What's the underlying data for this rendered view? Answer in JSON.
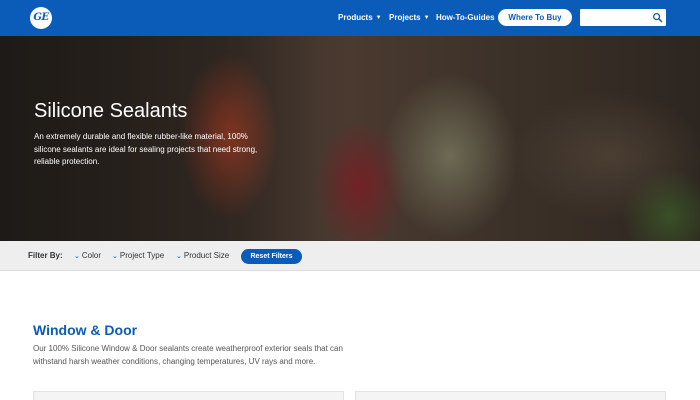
{
  "header": {
    "logo_text": "GE",
    "nav": [
      {
        "label": "Products",
        "has_dropdown": true
      },
      {
        "label": "Projects",
        "has_dropdown": true
      },
      {
        "label": "How-To-Guides",
        "has_dropdown": false
      }
    ],
    "buy_label": "Where To Buy",
    "search": {
      "value": "",
      "placeholder": ""
    },
    "brand_color": "#0a5cb8"
  },
  "hero": {
    "title": "Silicone Sealants",
    "description": "An extremely durable and flexible rubber-like material, 100% silicone sealants are ideal for sealing projects that need strong, reliable protection."
  },
  "filters": {
    "label": "Filter By:",
    "options": [
      "Color",
      "Project Type",
      "Product Size"
    ],
    "reset_label": "Reset Filters"
  },
  "section": {
    "title": "Window & Door",
    "description": "Our 100% Silicone Window & Door sealants create weatherproof exterior seals that can withstand harsh weather conditions, changing temperatures, UV rays and more."
  }
}
